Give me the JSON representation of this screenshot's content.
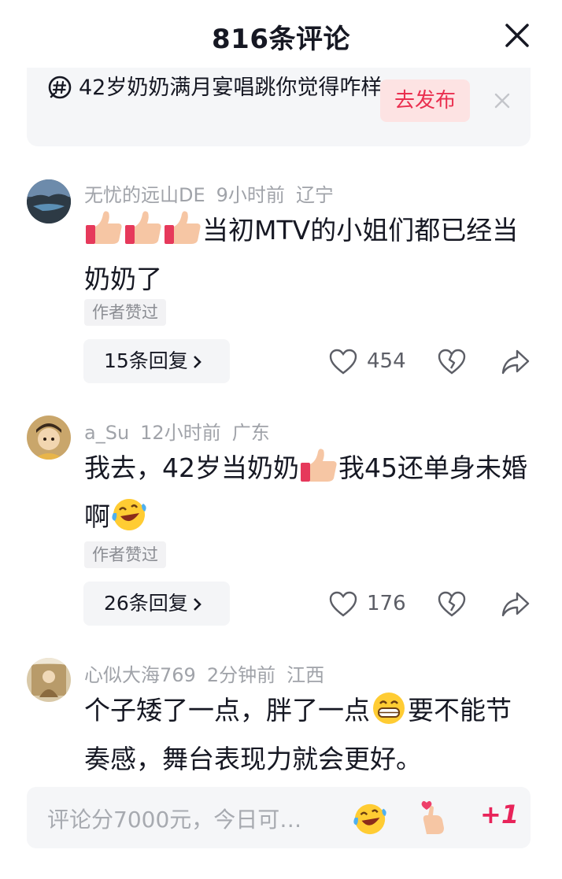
{
  "header": {
    "title": "816条评论",
    "close_icon": "close-icon"
  },
  "topic": {
    "text": "42岁奶奶满月宴唱跳你觉得咋样",
    "publish_label": "去发布",
    "icon": "hashtag-bubble-icon",
    "dismiss_icon": "close-icon"
  },
  "comments": [
    {
      "user": "无忧的远山DE",
      "time": "9小时前",
      "location": "辽宁",
      "text_before": "",
      "text_after": "当初MTV的小姐们都已经当奶奶了",
      "emojis": [
        "thumbs-up",
        "thumbs-up",
        "thumbs-up"
      ],
      "tag": "作者赞过",
      "replies": "15条回复",
      "likes": "454"
    },
    {
      "user": "a_Su",
      "time": "12小时前",
      "location": "广东",
      "text_part1": "我去，42岁当奶奶",
      "text_part2": "我45还单身未婚啊",
      "emojis": [
        "thumbs-up",
        "tears-of-joy"
      ],
      "tag": "作者赞过",
      "replies": "26条回复",
      "likes": "176"
    },
    {
      "user": "心似大海769",
      "time": "2分钟前",
      "location": "江西",
      "text_part1": "个子矮了一点，胖了一点",
      "text_part2": "要不能节奏感，舞台表现力就会更好。",
      "emojis": [
        "grinning"
      ]
    }
  ],
  "composer": {
    "placeholder": "评论分7000元，今日可…",
    "plus_one": "+1",
    "icons": [
      "tears-of-joy-icon",
      "heart-hand-icon"
    ]
  },
  "colors": {
    "accent": "#ea2f4f",
    "publish_bg": "#fde3e3",
    "meta": "#a0a3a9",
    "card_bg": "#f5f6f8"
  }
}
